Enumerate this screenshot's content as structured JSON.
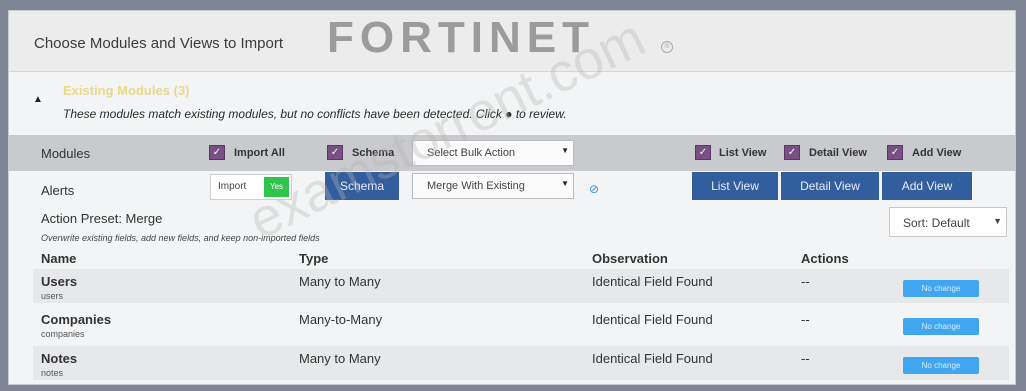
{
  "dialog": {
    "title": "Choose Modules and Views to Import",
    "logo_text": "FORTINET",
    "logo_mark": "®"
  },
  "existing": {
    "title": "Existing Modules (3)",
    "description": "These modules match existing modules, but no conflicts have been detected. Click",
    "description_suffix": "to review.",
    "eye_glyph": "●"
  },
  "modules_bar": {
    "label": "Modules",
    "import_all": "Import All",
    "schema": "Schema",
    "bulk_action": "Select Bulk Action",
    "list_view": "List View",
    "detail_view": "Detail View",
    "add_view": "Add View"
  },
  "alerts_bar": {
    "label": "Alerts",
    "import_label": "Import",
    "toggle_state": "Yes",
    "schema_button": "Schema",
    "merge_select": "Merge With Existing",
    "list_view_button": "List View",
    "detail_view_button": "Detail View",
    "add_view_button": "Add View"
  },
  "preset": {
    "title": "Action Preset: Merge",
    "description": "Overwrite existing fields, add new fields, and keep non-imported fields",
    "sort": "Sort: Default"
  },
  "table": {
    "headers": [
      "Name",
      "Type",
      "Observation",
      "Actions"
    ],
    "rows": [
      {
        "name": "Users",
        "sub": "users",
        "type": "Many to Many",
        "observation": "Identical Field Found",
        "actions": "--",
        "button": "No change"
      },
      {
        "name": "Companies",
        "sub": "companies",
        "type": "Many-to-Many",
        "observation": "Identical Field Found",
        "actions": "--",
        "button": "No change"
      },
      {
        "name": "Notes",
        "sub": "notes",
        "type": "Many to Many",
        "observation": "Identical Field Found",
        "actions": "--",
        "button": "No change"
      }
    ]
  },
  "watermark": "examstorrent.com",
  "colors": {
    "accent_button": "#325e9e",
    "checkbox": "#7a4f83",
    "toggle_on": "#2fc44b",
    "no_change": "#40a6f0"
  }
}
